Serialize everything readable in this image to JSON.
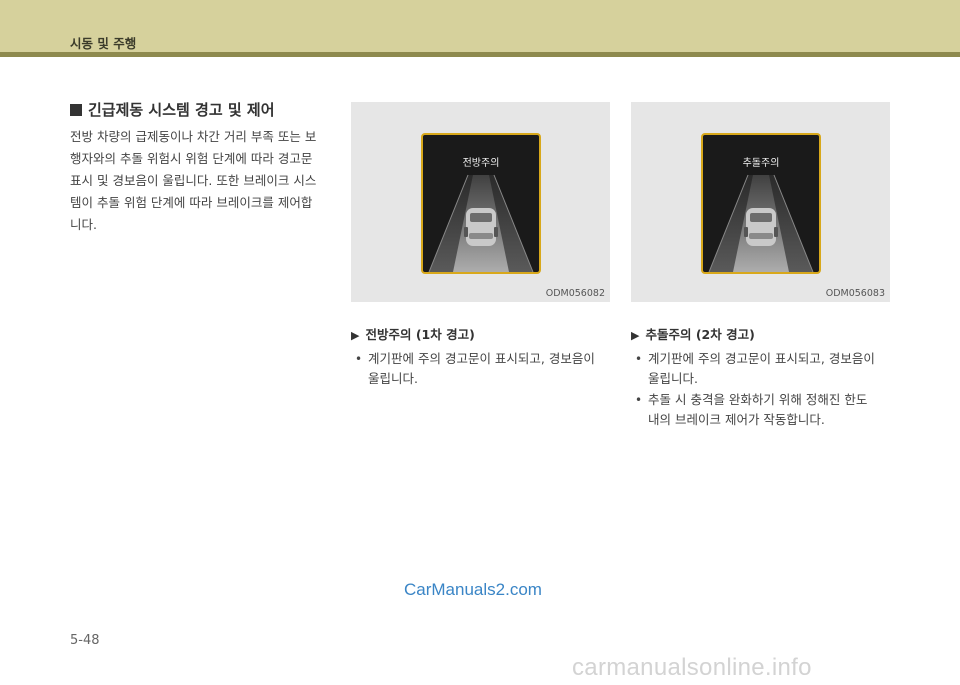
{
  "header": {
    "title": "시동 및 주행"
  },
  "section": {
    "heading": "긴급제동 시스템 경고 및 제어",
    "body": "전방 차량의 급제동이나 차간 거리 부족 또는 보\n행자와의 추돌 위험시 위험 단계에 따라 경고문\n표시 및 경보음이 울립니다. 또한 브레이크 시스\n템이 추돌 위험 단계에 따라 브레이크를 제어합\n니다."
  },
  "figures": [
    {
      "screen_label": "전방주의",
      "code": "ODM056082"
    },
    {
      "screen_label": "추돌주의",
      "code": "ODM056083"
    }
  ],
  "warnings": [
    {
      "heading": "전방주의 (1차 경고)",
      "bullets": [
        "계기판에 주의 경고문이 표시되고, 경보음이\n울립니다."
      ]
    },
    {
      "heading": "추돌주의 (2차 경고)",
      "bullets": [
        "계기판에 주의 경고문이 표시되고, 경보음이\n울립니다.",
        "추돌 시 충격을 완화하기 위해 정해진 한도\n내의 브레이크 제어가 작동합니다."
      ]
    }
  ],
  "watermark": "CarManuals2.com",
  "page_number": "5-48",
  "footer_watermark": "carmanualsonline.info",
  "icons": {
    "heading_marker": "square-icon",
    "subheading_marker": "arrow-right-icon",
    "bullet": "bullet-dot-icon"
  },
  "colors": {
    "header_bg": "#d6d19c",
    "header_line": "#8e8a4e",
    "screen_border": "#d8a81b",
    "watermark": "#3a85c6"
  }
}
